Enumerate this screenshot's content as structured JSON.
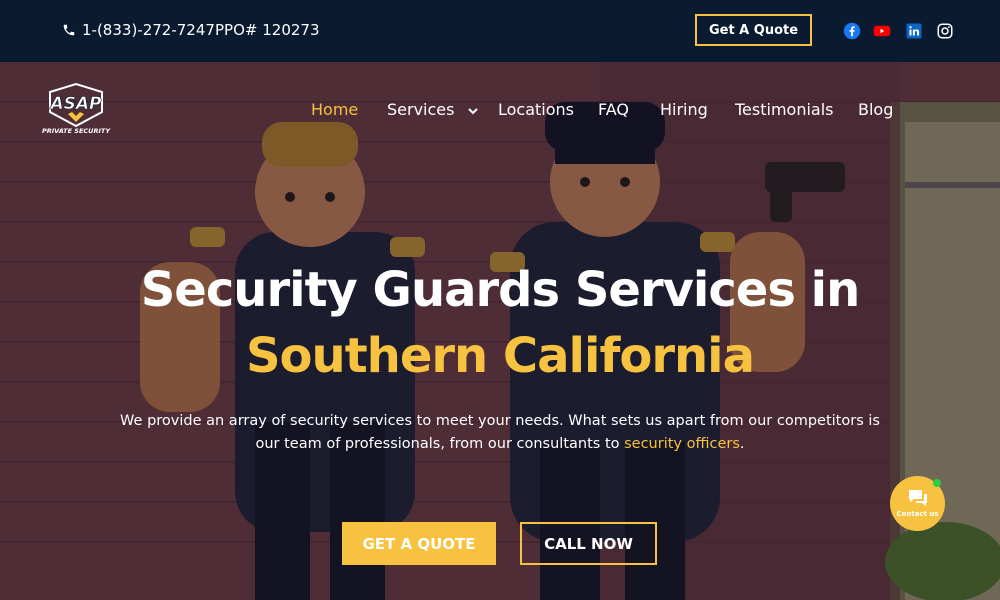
{
  "topbar": {
    "phone": "1-(833)-272-7247",
    "ppo": "PPO# 120273",
    "quote_button": "Get A Quote",
    "social_icons": [
      "facebook-icon",
      "youtube-icon",
      "linkedin-icon",
      "instagram-icon"
    ]
  },
  "logo": {
    "text": "ASAP",
    "subtext": "PRIVATE SECURITY"
  },
  "nav": {
    "items": [
      {
        "label": "Home",
        "active": true
      },
      {
        "label": "Services",
        "has_dropdown": true
      },
      {
        "label": "Locations"
      },
      {
        "label": "FAQ"
      },
      {
        "label": "Hiring"
      },
      {
        "label": "Testimonials"
      },
      {
        "label": "Blog"
      }
    ]
  },
  "hero": {
    "headline_line1": "Security Guards Services in",
    "headline_line2": "Southern California",
    "description_part1": "We provide an array of security services to meet your needs. What sets us apart from our competitors is our team of professionals, from our consultants to ",
    "description_link": "security officers",
    "description_end": ".",
    "quote_button": "GET A QUOTE",
    "call_button": "CALL NOW"
  },
  "contact_widget": {
    "label": "Contact us"
  },
  "colors": {
    "accent": "#f7c23f",
    "topbar_bg": "#0a1a30",
    "facebook": "#1877f2",
    "youtube": "#ff0000",
    "linkedin": "#0a66c2",
    "status_online": "#2ecc40"
  }
}
